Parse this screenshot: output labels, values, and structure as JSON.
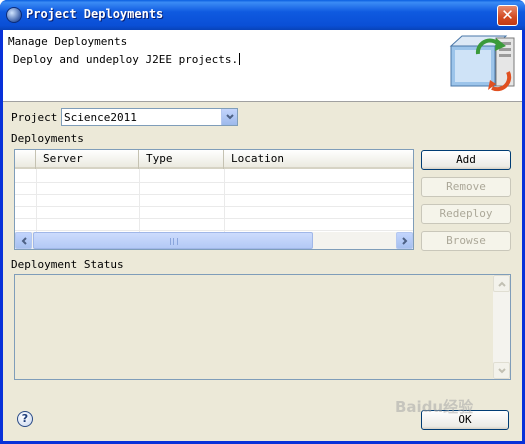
{
  "window": {
    "title": "Project Deployments",
    "close_glyph": "✕"
  },
  "banner": {
    "title": "Manage Deployments",
    "description": "Deploy and undeploy J2EE projects."
  },
  "project": {
    "label": "Project",
    "selected": "Science2011"
  },
  "deployments": {
    "label": "Deployments",
    "columns": [
      "Server",
      "Type",
      "Location"
    ],
    "rows": []
  },
  "actions": {
    "add": "Add",
    "remove": "Remove",
    "redeploy": "Redeploy",
    "browse": "Browse"
  },
  "status": {
    "label": "Deployment Status",
    "text": ""
  },
  "footer": {
    "ok": "OK",
    "help_glyph": "?"
  },
  "watermark": "Baidu经验",
  "colors": {
    "titlebar": "#0a4fd6",
    "dialog_bg": "#ece9d8",
    "disabled_text": "#aca899"
  }
}
